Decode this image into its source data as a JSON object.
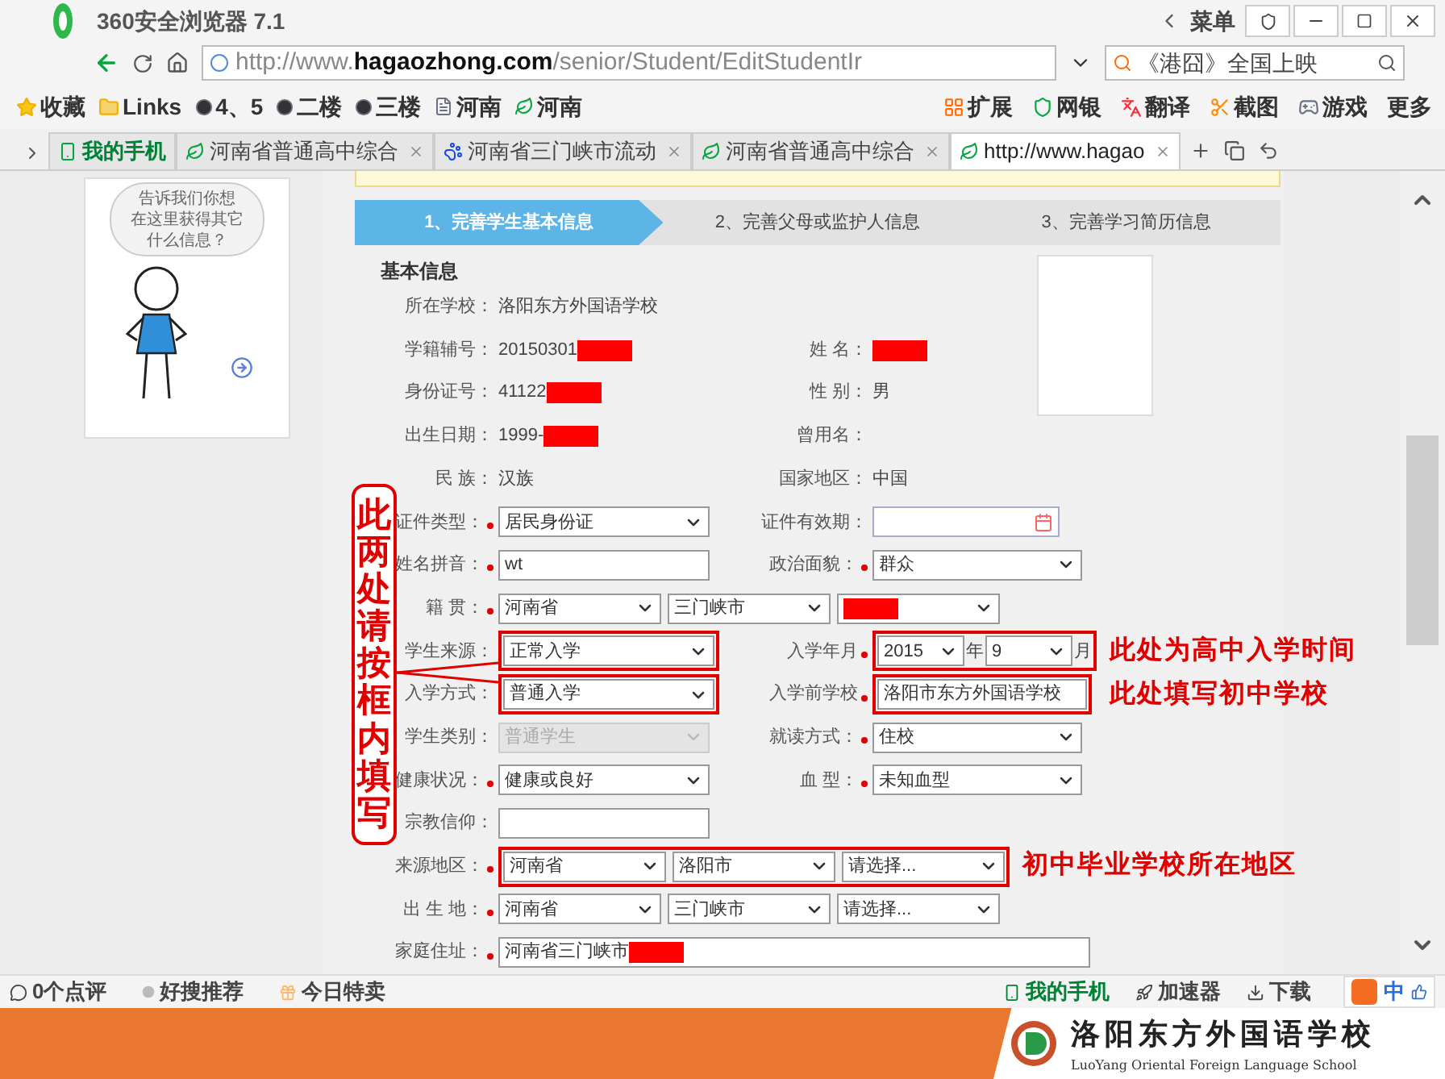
{
  "browser": {
    "title": "360安全浏览器 7.1",
    "menu": "菜单",
    "url": "http://www.**hagaozhong.com**/senior/Student/EditStudentIr",
    "search": "《港囧》全国上映",
    "bookmarks": [
      {
        "label": "收藏",
        "kind": "star"
      },
      {
        "label": "Links",
        "kind": "folder"
      },
      {
        "label": "4、5",
        "kind": "dot"
      },
      {
        "label": "二楼",
        "kind": "dot"
      },
      {
        "label": "三楼",
        "kind": "dot"
      },
      {
        "label": "河南",
        "kind": "page"
      },
      {
        "label": "河南",
        "kind": "leaf"
      }
    ],
    "tools": [
      {
        "label": "扩展"
      },
      {
        "label": "网银"
      },
      {
        "label": "翻译"
      },
      {
        "label": "截图"
      },
      {
        "label": "游戏"
      },
      {
        "label": "更多"
      }
    ],
    "tabs": [
      {
        "label": "我的手机",
        "kind": "phone",
        "selected": false
      },
      {
        "label": "河南省普通高中综合",
        "kind": "leaf",
        "selected": false
      },
      {
        "label": "河南省三门峡市流动",
        "kind": "paw",
        "selected": false
      },
      {
        "label": "河南省普通高中综合",
        "kind": "leaf",
        "selected": false
      },
      {
        "label": "http://www.hagao",
        "kind": "leaf",
        "selected": true
      }
    ]
  },
  "sidebar": {
    "bubble": [
      "告诉我们你想",
      "在这里获得其它",
      "什么信息？"
    ]
  },
  "steps": [
    {
      "label": "1、完善学生基本信息",
      "selected": true
    },
    {
      "label": "2、完善父母或监护人信息",
      "selected": false
    },
    {
      "label": "3、完善学习简历信息",
      "selected": false
    }
  ],
  "section_title": "基本信息",
  "rows": [
    {
      "left": {
        "label": "所在学校：",
        "kind": "text",
        "value": "洛阳东方外国语学校"
      }
    },
    {
      "left": {
        "label": "学籍辅号：",
        "kind": "text",
        "value": "20150301",
        "redacted": true
      },
      "right": {
        "label": "姓 名：",
        "kind": "text",
        "redacted": true
      }
    },
    {
      "left": {
        "label": "身份证号：",
        "kind": "text",
        "value": "41122",
        "redacted": true
      },
      "right": {
        "label": "性 别：",
        "kind": "text",
        "value": "男"
      }
    },
    {
      "left": {
        "label": "出生日期：",
        "kind": "text",
        "value": "1999-",
        "redacted": true
      },
      "right": {
        "label": "曾用名：",
        "kind": "text"
      }
    },
    {
      "left": {
        "label": "民 族：",
        "kind": "text",
        "value": "汉族"
      },
      "right": {
        "label": "国家地区：",
        "kind": "text",
        "value": "中国"
      }
    },
    {
      "left": {
        "label": "证件类型：",
        "kind": "select",
        "required": true,
        "value": "居民身份证",
        "disabled": false
      },
      "right": {
        "label": "证件有效期：",
        "kind": "date"
      }
    },
    {
      "left": {
        "label": "姓名拼音：",
        "kind": "input",
        "required": true,
        "value": "wt"
      },
      "right": {
        "label": "政治面貌：",
        "kind": "select",
        "required": true,
        "value": "群众",
        "disabled": false
      }
    },
    {
      "left": {
        "label": "籍 贯：",
        "kind": "selects",
        "required": true,
        "options": [
          {
            "value": "河南省"
          },
          {
            "value": "三门峡市"
          },
          {
            "redacted": true
          }
        ]
      }
    },
    {
      "left": {
        "label": "学生来源：",
        "kind": "select",
        "value": "正常入学",
        "disabled": false,
        "highlighted": true
      },
      "right": {
        "label": "入学年月",
        "kind": "year_month",
        "required": true,
        "year": "2015",
        "year_unit": "年",
        "month": "9",
        "month_unit": "月",
        "highlighted": true
      },
      "note": "此处为高中入学时间"
    },
    {
      "left": {
        "label": "入学方式：",
        "kind": "select",
        "value": "普通入学",
        "disabled": false,
        "highlighted": true
      },
      "right": {
        "label": "入学前学校",
        "kind": "input",
        "required": true,
        "value": "洛阳市东方外国语学校",
        "highlighted": true
      },
      "note": "此处填写初中学校"
    },
    {
      "left": {
        "label": "学生类别：",
        "kind": "select",
        "value": "普通学生",
        "disabled": true
      },
      "right": {
        "label": "就读方式：",
        "kind": "select",
        "required": true,
        "value": "住校",
        "disabled": false
      }
    },
    {
      "left": {
        "label": "健康状况：",
        "kind": "select",
        "required": true,
        "value": "健康或良好",
        "disabled": false
      },
      "right": {
        "label": "血 型：",
        "kind": "select",
        "required": true,
        "value": "未知血型",
        "disabled": false
      }
    },
    {
      "left": {
        "label": "宗教信仰：",
        "kind": "input"
      }
    },
    {
      "left": {
        "label": "来源地区：",
        "kind": "selects",
        "required": true,
        "highlighted": true,
        "options": [
          {
            "value": "河南省"
          },
          {
            "value": "洛阳市"
          },
          {
            "value": "请选择..."
          }
        ]
      },
      "note": "初中毕业学校所在地区"
    },
    {
      "left": {
        "label": "出 生 地：",
        "kind": "selects",
        "required": true,
        "options": [
          {
            "value": "河南省"
          },
          {
            "value": "三门峡市"
          },
          {
            "value": "请选择..."
          }
        ]
      }
    },
    {
      "left": {
        "label": "家庭住址：",
        "kind": "input",
        "wide": true,
        "required": true,
        "value": "河南省三门峡市",
        "redacted": true
      }
    }
  ],
  "callout": "此两处请按框内填写",
  "status": {
    "left": [
      {
        "label": "0个点评"
      },
      {
        "label": "好搜推荐"
      },
      {
        "label": "今日特卖"
      }
    ],
    "right": [
      {
        "label": "我的手机"
      },
      {
        "label": "加速器"
      },
      {
        "label": "下载"
      }
    ],
    "ime": "中"
  },
  "footer": {
    "school": "洛阳东方外国语学校",
    "english": "LuoYang Oriental Foreign Language School"
  }
}
